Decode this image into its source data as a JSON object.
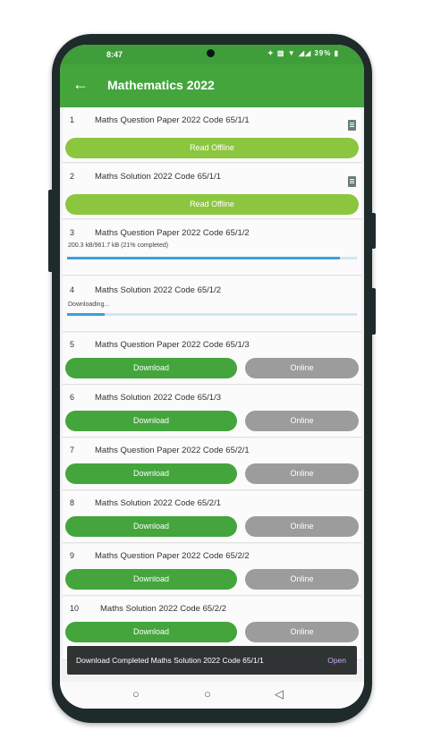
{
  "status": {
    "time": "8:47",
    "icons": "✦ ▥ ▼ ◢◢ 39% ▮",
    "battery": "39%"
  },
  "appbar": {
    "back_icon": "arrow-left-icon",
    "title": "Mathematics 2022"
  },
  "items": [
    {
      "num": "1",
      "title": "Maths Question Paper 2022 Code 65/1/1",
      "state": "offline",
      "button": "Read Offline"
    },
    {
      "num": "2",
      "title": "Maths Solution 2022 Code 65/1/1",
      "state": "offline",
      "button": "Read Offline"
    },
    {
      "num": "3",
      "title": "Maths Question Paper 2022 Code 65/1/2",
      "state": "downloading",
      "status": "200.3 kB/961.7 kB (21% completed)",
      "progress": 0.94
    },
    {
      "num": "4",
      "title": "Maths Solution 2022 Code 65/1/2",
      "state": "downloading",
      "status": "Downloading...",
      "progress": 0.13
    },
    {
      "num": "5",
      "title": "Maths Question Paper 2022 Code 65/1/3",
      "state": "download",
      "download": "Download",
      "online": "Online"
    },
    {
      "num": "6",
      "title": "Maths Solution 2022 Code 65/1/3",
      "state": "download",
      "download": "Download",
      "online": "Online"
    },
    {
      "num": "7",
      "title": "Maths Question Paper 2022 Code 65/2/1",
      "state": "download",
      "download": "Download",
      "online": "Online"
    },
    {
      "num": "8",
      "title": "Maths Solution 2022 Code 65/2/1",
      "state": "download",
      "download": "Download",
      "online": "Online"
    },
    {
      "num": "9",
      "title": "Maths Question Paper 2022 Code 65/2/2",
      "state": "download",
      "download": "Download",
      "online": "Online"
    },
    {
      "num": "10",
      "title": "Maths Solution 2022 Code 65/2/2",
      "state": "download",
      "download": "Download",
      "online": "Online"
    }
  ],
  "snackbar": {
    "message": "Download Completed Maths Solution 2022 Code 65/1/1",
    "action": "Open"
  },
  "navbar": {
    "recents_icon": "square-icon",
    "home_icon": "circle-icon",
    "back_icon": "triangle-back-icon"
  },
  "colors": {
    "appbar": "#43a53c",
    "offline_button": "#8cc63f",
    "download_button": "#43a53c",
    "online_button": "#9c9c9c",
    "progress": "#3d9fdc"
  }
}
